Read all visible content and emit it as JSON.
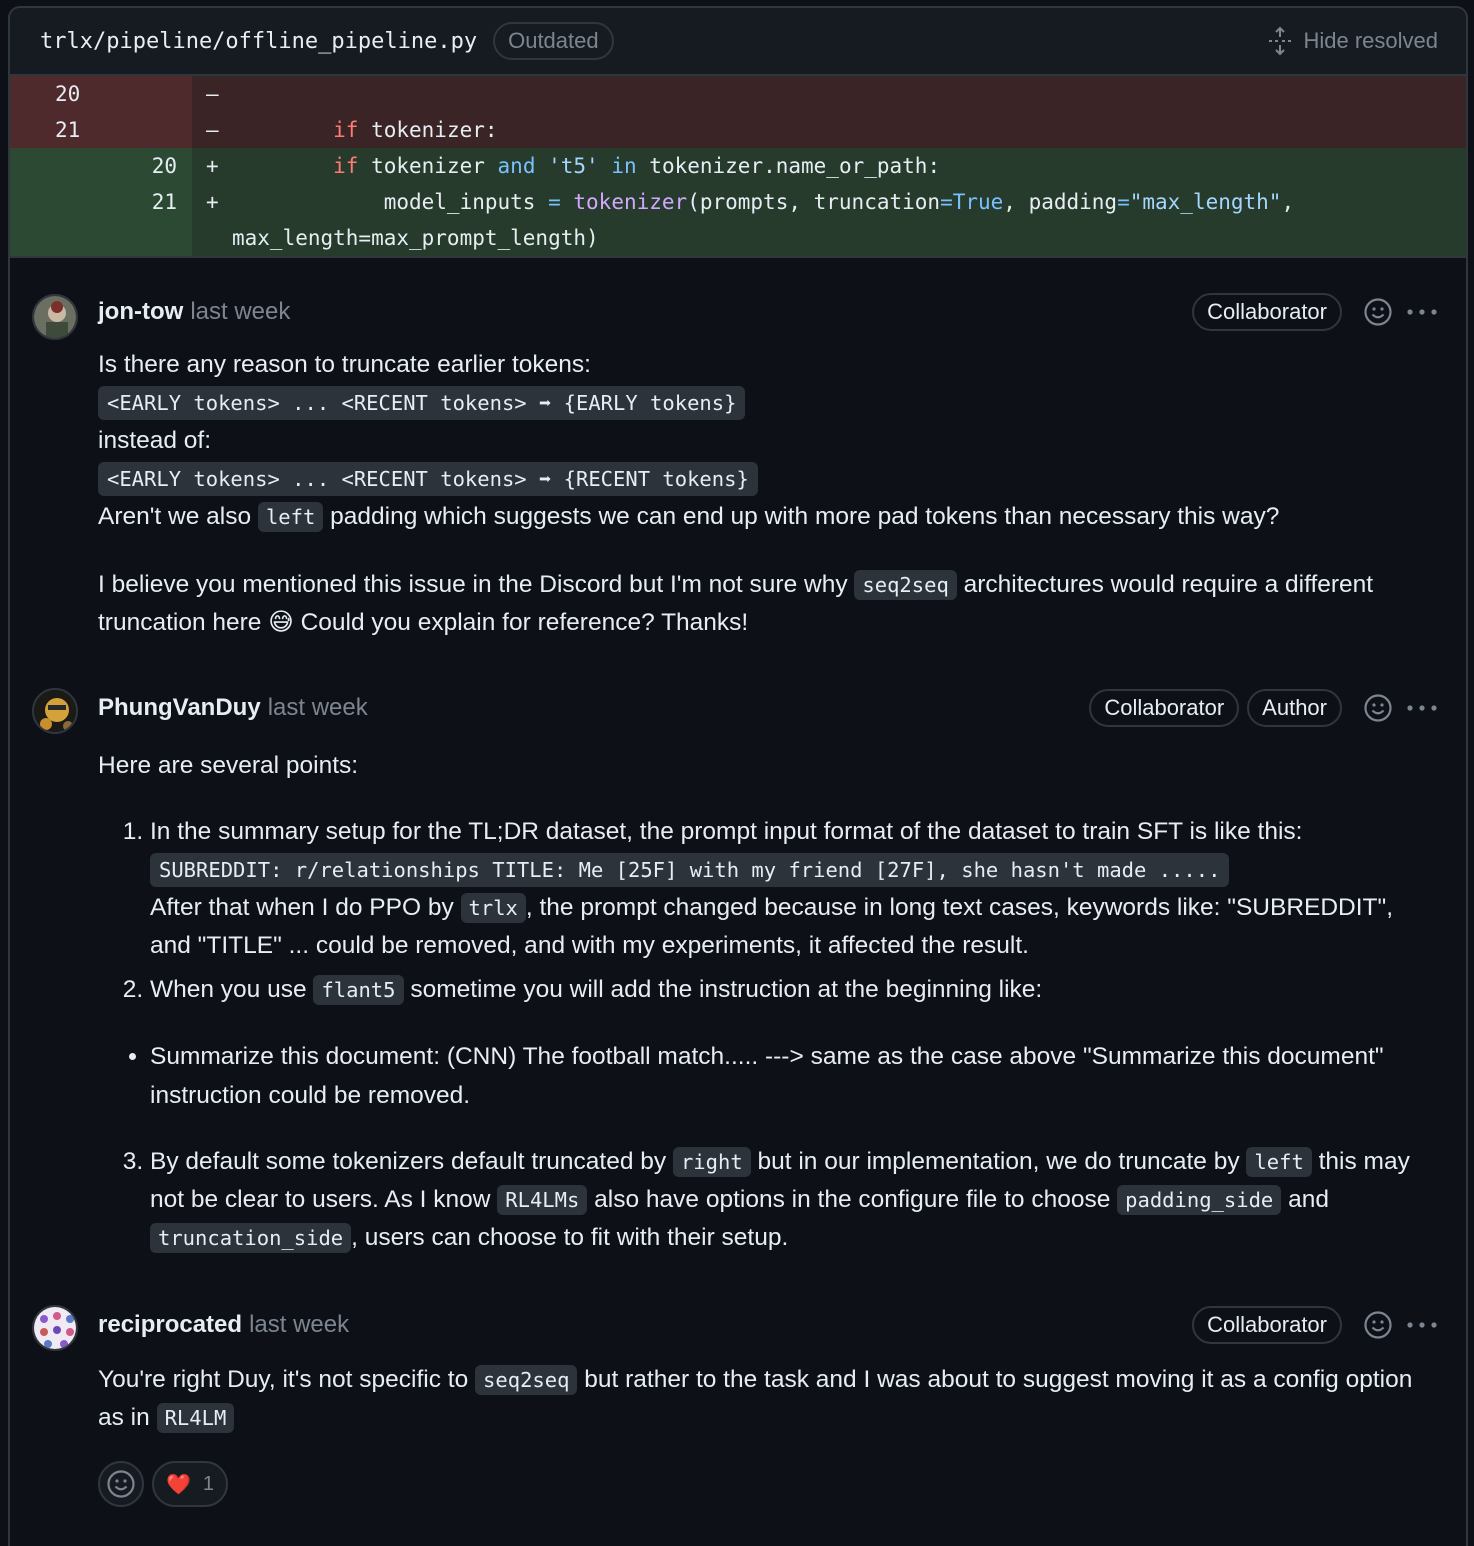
{
  "file": {
    "path": "trlx/pipeline/offline_pipeline.py",
    "status": "Outdated",
    "hide_resolved": "Hide resolved"
  },
  "diff": {
    "rows": [
      {
        "old": "20",
        "new": "",
        "sign": "–",
        "type": "del"
      },
      {
        "old": "21",
        "new": "",
        "sign": "–",
        "type": "del"
      },
      {
        "old": "",
        "new": "20",
        "sign": "+",
        "type": "add"
      },
      {
        "old": "",
        "new": "21",
        "sign": "+",
        "type": "add"
      }
    ],
    "wrap_line": "max_length=max_prompt_length)"
  },
  "comments": [
    {
      "author": "jon-tow",
      "time": "last week",
      "badges": [
        "Collaborator"
      ],
      "p1": "Is there any reason to truncate earlier tokens:",
      "code1": "<EARLY tokens> ... <RECENT tokens> ➡ {EARLY tokens}",
      "p2": "instead of:",
      "code2": "<EARLY tokens> ... <RECENT tokens> ➡ {RECENT tokens}",
      "p3a": "Aren't we also",
      "p3code": "left",
      "p3b": "padding which suggests we can end up with more pad tokens than necessary this way?",
      "p4a": "I believe you mentioned this issue in the Discord but I'm not sure why",
      "p4code": "seq2seq",
      "p4b": "architectures would require a different truncation here",
      "p4emoji": "😅",
      "p4c": "Could you explain for reference? Thanks!"
    },
    {
      "author": "PhungVanDuy",
      "time": "last week",
      "badges": [
        "Collaborator",
        "Author"
      ],
      "intro": "Here are several points:",
      "li1a": "In the summary setup for the TL;DR dataset, the prompt input format of the dataset to train SFT is like this:",
      "li1code": "SUBREDDIT: r/relationships TITLE: Me [25F] with my friend [27F], she hasn't made .....",
      "li1b": "After that when I do PPO by",
      "li1code2": "trlx",
      "li1c": ", the prompt changed because in long text cases, keywords like: \"SUBREDDIT\", and \"TITLE\" ... could be removed, and with my experiments, it affected the result.",
      "li2a": "When you use",
      "li2code": "flant5",
      "li2b": "sometime you will add the instruction at the beginning like:",
      "bullet": "Summarize this document: (CNN) The football match..... ---> same as the case above \"Summarize this document\" instruction could be removed.",
      "li3a": "By default some tokenizers default truncated by",
      "li3code1": "right",
      "li3b": "but in our implementation, we do truncate by",
      "li3code2": "left",
      "li3c": "this may not be clear to users. As I know",
      "li3code3": "RL4LMs",
      "li3d": "also have options in the configure file to choose",
      "li3code4": "padding_side",
      "li3e": "and",
      "li3code5": "truncation_side",
      "li3f": ", users can choose to fit with their setup."
    },
    {
      "author": "reciprocated",
      "time": "last week",
      "badges": [
        "Collaborator"
      ],
      "p1a": "You're right Duy, it's not specific to",
      "p1code": "seq2seq",
      "p1b": "but rather to the task and I was about to suggest moving it as a config option as in",
      "p1code2": "RL4LM",
      "reaction_emoji": "❤️",
      "reaction_count": "1"
    }
  ],
  "icons": [
    "unfold-icon",
    "smiley-icon",
    "kebab-horizontal-icon"
  ],
  "colors": {
    "bg": "#0d1117",
    "del_bg": "#3a2426",
    "add_bg": "#263b2c",
    "keyword": "#ff7b72",
    "builtin": "#79c0ff",
    "string": "#a5d6ff",
    "function": "#d2a8ff"
  }
}
